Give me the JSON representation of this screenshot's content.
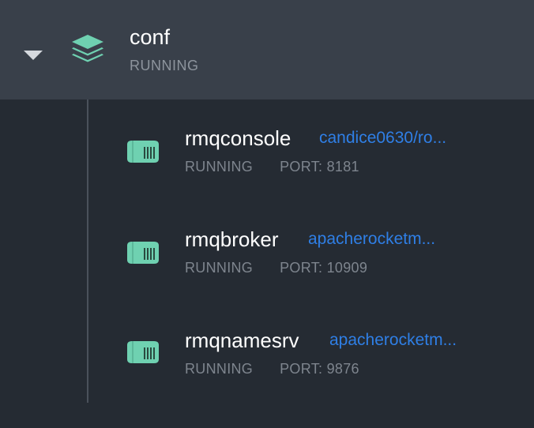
{
  "group": {
    "name": "conf",
    "status": "RUNNING",
    "expanded": true,
    "icon": "stack-layers-icon"
  },
  "colors": {
    "accent": "#6fd1b1",
    "link": "#2f7fe6",
    "header_bg": "#39404a",
    "body_bg": "#252b33"
  },
  "containers": [
    {
      "name": "rmqconsole",
      "image": "candice0630/ro...",
      "status": "RUNNING",
      "port": "PORT: 8181",
      "icon": "container-icon"
    },
    {
      "name": "rmqbroker",
      "image": "apacherocketm...",
      "status": "RUNNING",
      "port": "PORT: 10909",
      "icon": "container-icon"
    },
    {
      "name": "rmqnamesrv",
      "image": "apacherocketm...",
      "status": "RUNNING",
      "port": "PORT: 9876",
      "icon": "container-icon"
    }
  ]
}
